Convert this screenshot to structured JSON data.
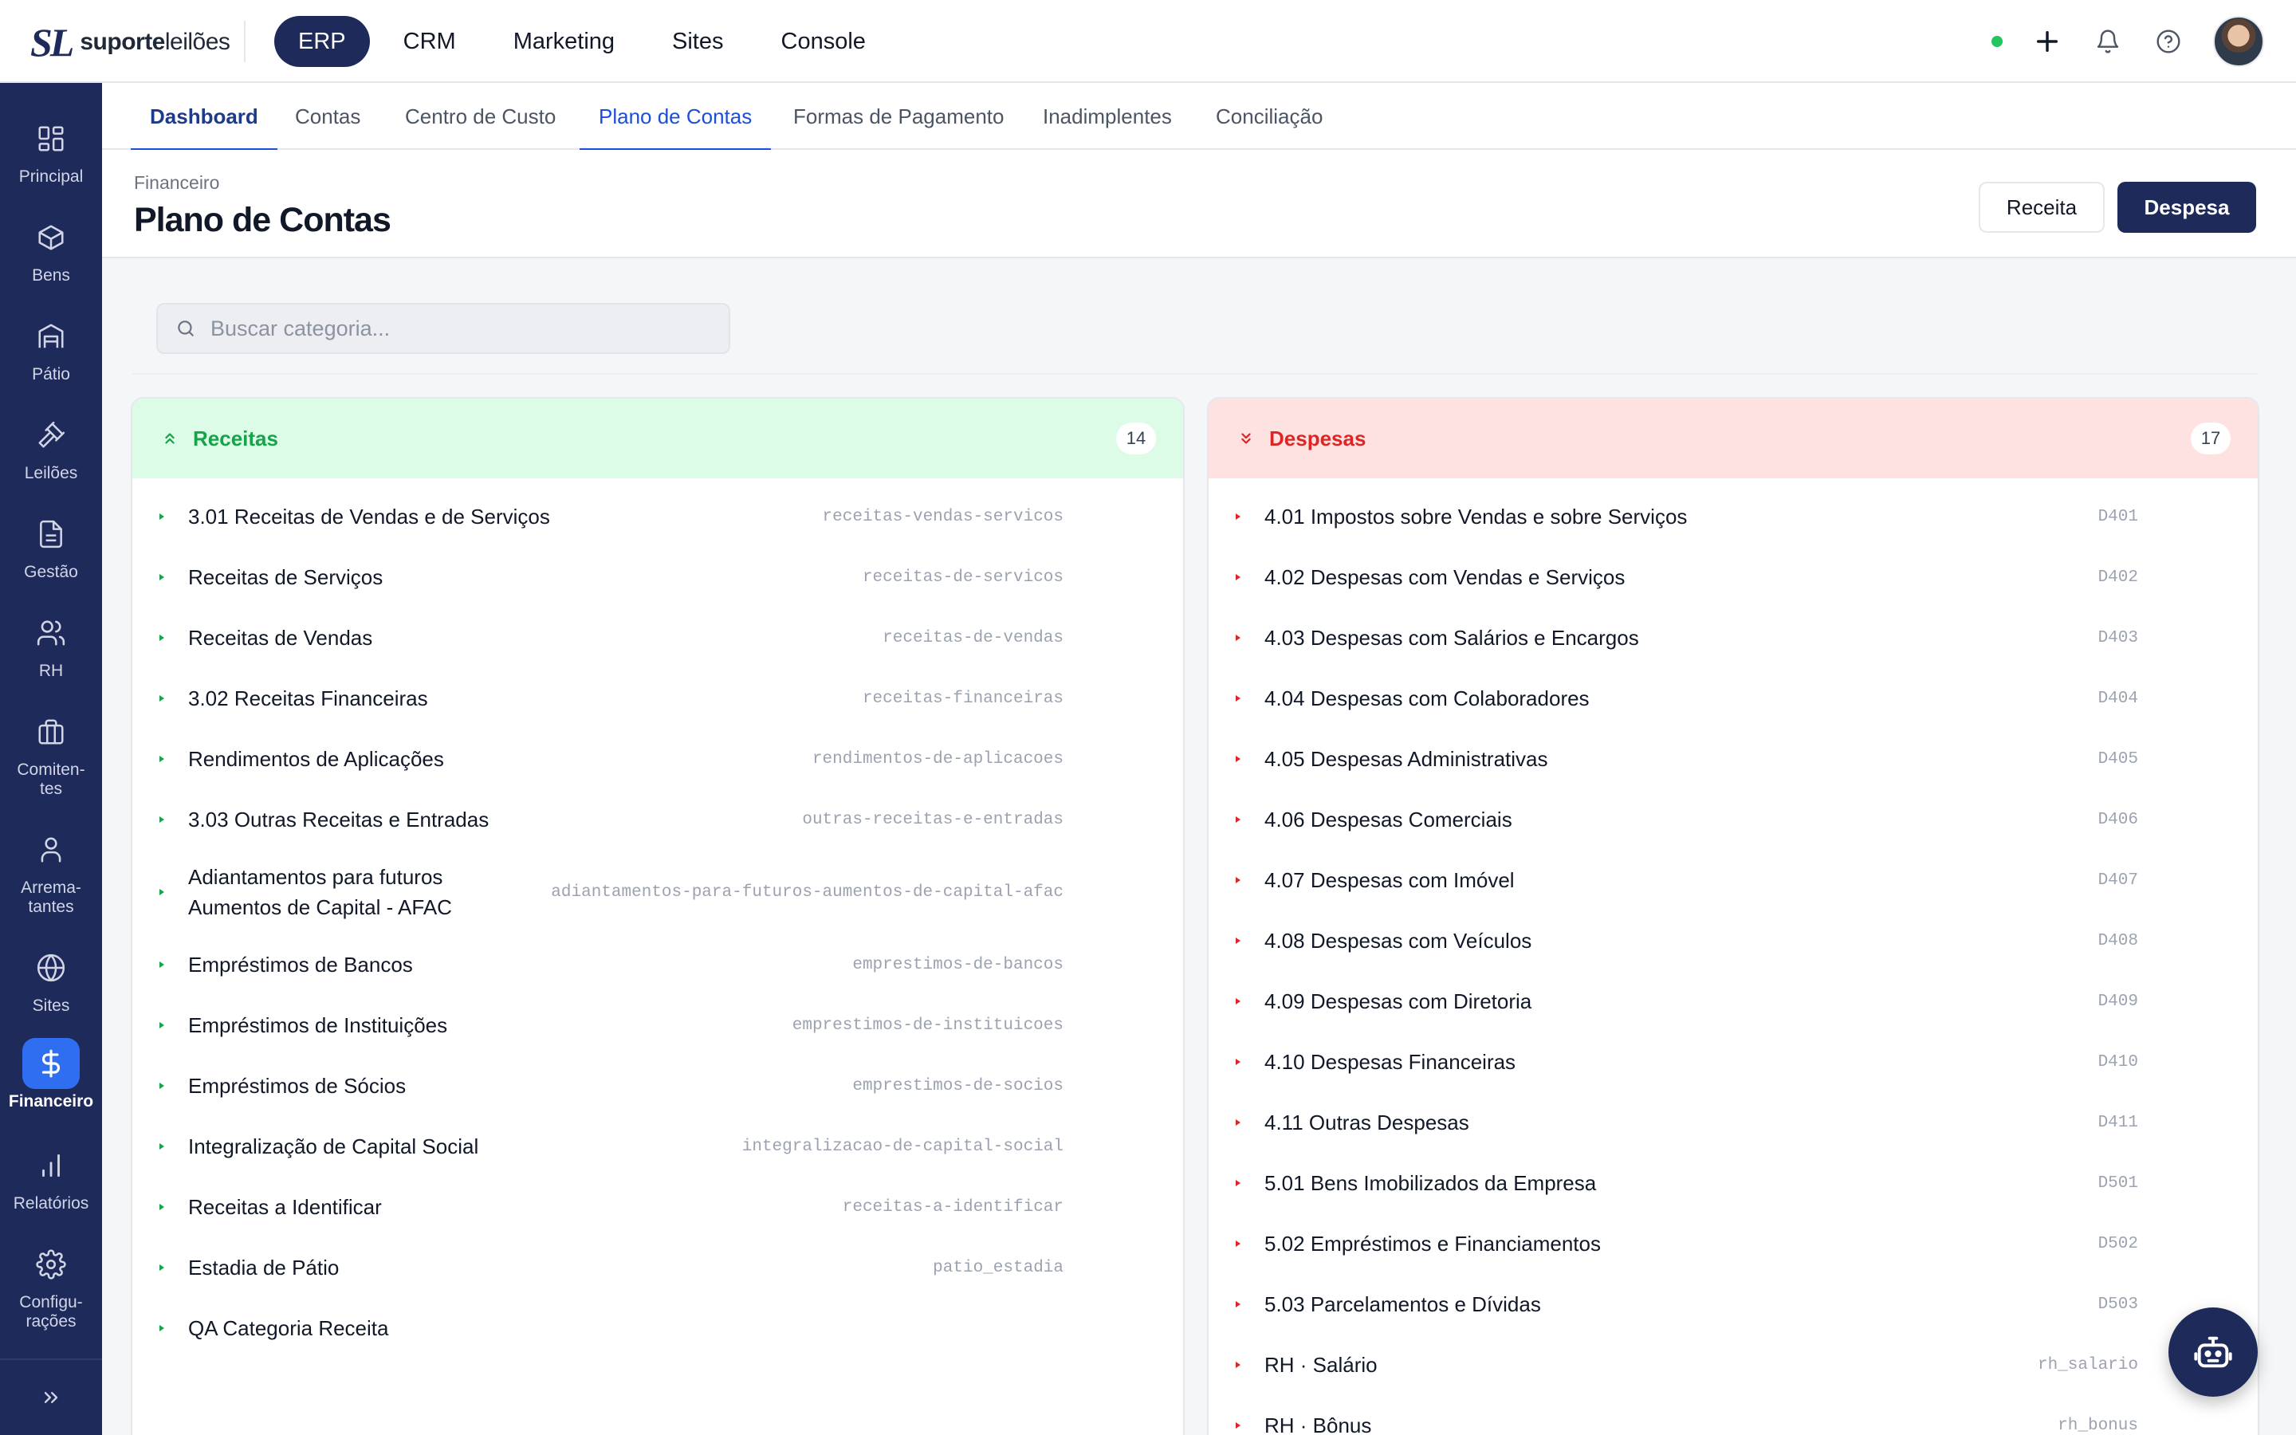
{
  "brand": {
    "mark": "SL",
    "name_bold": "suporte",
    "name_light": "leilões"
  },
  "topnav": [
    {
      "label": "ERP",
      "active": true
    },
    {
      "label": "CRM"
    },
    {
      "label": "Marketing"
    },
    {
      "label": "Sites"
    },
    {
      "label": "Console"
    }
  ],
  "sidebar": [
    {
      "label": "Principal",
      "icon": "grid-icon"
    },
    {
      "label": "Bens",
      "icon": "box-icon"
    },
    {
      "label": "Pátio",
      "icon": "warehouse-icon"
    },
    {
      "label": "Leilões",
      "icon": "gavel-icon"
    },
    {
      "label": "Gestão",
      "icon": "document-icon"
    },
    {
      "label": "RH",
      "icon": "users-icon"
    },
    {
      "label": "Comiten-\ntes",
      "icon": "briefcase-icon"
    },
    {
      "label": "Arrema-\ntantes",
      "icon": "user-icon"
    },
    {
      "label": "Sites",
      "icon": "globe-icon"
    },
    {
      "label": "Financeiro",
      "icon": "dollar-icon",
      "active": true
    },
    {
      "label": "Relatórios",
      "icon": "bar-chart-icon"
    },
    {
      "label": "Configu-\nrações",
      "icon": "gear-icon"
    }
  ],
  "tabs": [
    {
      "label": "Dashboard",
      "active": true
    },
    {
      "label": "Contas"
    },
    {
      "label": "Centro de Custo"
    },
    {
      "label": "Plano de Contas",
      "underline": true
    },
    {
      "label": "Formas de Pagamento"
    },
    {
      "label": "Inadimplentes"
    },
    {
      "label": "Conciliação"
    }
  ],
  "header": {
    "breadcrumb": "Financeiro",
    "title": "Plano de Contas",
    "receita_button": "Receita",
    "despesa_button": "Despesa"
  },
  "search": {
    "placeholder": "Buscar categoria..."
  },
  "receitas": {
    "title": "Receitas",
    "count": "14",
    "color": "#16a34a",
    "items": [
      {
        "name": "3.01 Receitas de Vendas e de Serviços",
        "code": "receitas-vendas-servicos"
      },
      {
        "name": "Receitas de Serviços",
        "code": "receitas-de-servicos"
      },
      {
        "name": "Receitas de Vendas",
        "code": "receitas-de-vendas"
      },
      {
        "name": "3.02 Receitas Financeiras",
        "code": "receitas-financeiras"
      },
      {
        "name": "Rendimentos de Aplicações",
        "code": "rendimentos-de-aplicacoes"
      },
      {
        "name": "3.03 Outras Receitas e Entradas",
        "code": "outras-receitas-e-entradas"
      },
      {
        "name": "Adiantamentos para futuros Aumentos de Capital - AFAC",
        "code": "adiantamentos-para-futuros-aumentos-de-capital-afac"
      },
      {
        "name": "Empréstimos de Bancos",
        "code": "emprestimos-de-bancos"
      },
      {
        "name": "Empréstimos de Instituições",
        "code": "emprestimos-de-instituicoes"
      },
      {
        "name": "Empréstimos de Sócios",
        "code": "emprestimos-de-socios"
      },
      {
        "name": "Integralização de Capital Social",
        "code": "integralizacao-de-capital-social"
      },
      {
        "name": "Receitas a Identificar",
        "code": "receitas-a-identificar"
      },
      {
        "name": "Estadia de Pátio",
        "code": "patio_estadia"
      },
      {
        "name": "QA Categoria Receita",
        "code": ""
      }
    ]
  },
  "despesas": {
    "title": "Despesas",
    "count": "17",
    "color": "#dc2626",
    "items": [
      {
        "name": "4.01 Impostos sobre Vendas e sobre Serviços",
        "code": "D401"
      },
      {
        "name": "4.02 Despesas com Vendas e Serviços",
        "code": "D402"
      },
      {
        "name": "4.03 Despesas com Salários e Encargos",
        "code": "D403"
      },
      {
        "name": "4.04 Despesas com Colaboradores",
        "code": "D404"
      },
      {
        "name": "4.05 Despesas Administrativas",
        "code": "D405"
      },
      {
        "name": "4.06 Despesas Comerciais",
        "code": "D406"
      },
      {
        "name": "4.07 Despesas com Imóvel",
        "code": "D407"
      },
      {
        "name": "4.08 Despesas com Veículos",
        "code": "D408"
      },
      {
        "name": "4.09 Despesas com Diretoria",
        "code": "D409"
      },
      {
        "name": "4.10 Despesas Financeiras",
        "code": "D410"
      },
      {
        "name": "4.11 Outras Despesas",
        "code": "D411"
      },
      {
        "name": "5.01 Bens Imobilizados da Empresa",
        "code": "D501"
      },
      {
        "name": "5.02 Empréstimos e Financiamentos",
        "code": "D502"
      },
      {
        "name": "5.03 Parcelamentos e Dívidas",
        "code": "D503"
      },
      {
        "name": "RH · Salário",
        "code": "rh_salario"
      },
      {
        "name": "RH · Bônus",
        "code": "rh_bonus"
      }
    ]
  },
  "assistant": {
    "icon": "robot-icon"
  }
}
